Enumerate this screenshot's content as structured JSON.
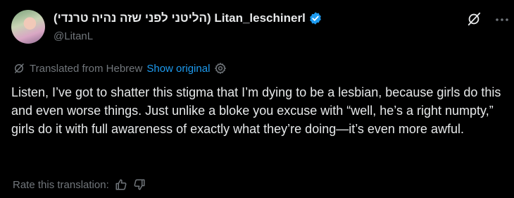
{
  "author": {
    "display_name": "(הליטני לפני שזה נהיה טרנדי) Litan_leschinerl",
    "handle": "@LitanL"
  },
  "translation": {
    "label": "Translated from Hebrew",
    "show_original": "Show original"
  },
  "tweet": {
    "text": "Listen, I’ve got to shatter this stigma that I’m dying to be a lesbian, because girls do this and even worse things. Just unlike a bloke you excuse with “well, he’s a right numpty,” girls do it with full awareness of exactly what they’re doing—it’s even more awful."
  },
  "rating": {
    "label": "Rate this translation:"
  },
  "icons": {
    "verified": "verified-badge-icon",
    "grok": "grok-icon",
    "more": "more-icon",
    "translate": "translate-icon",
    "settings": "gear-icon",
    "thumbs_up": "thumbs-up-icon",
    "thumbs_down": "thumbs-down-icon"
  },
  "colors": {
    "background": "#000000",
    "text": "#e7e9ea",
    "muted": "#71767b",
    "link": "#1d9bf0"
  }
}
